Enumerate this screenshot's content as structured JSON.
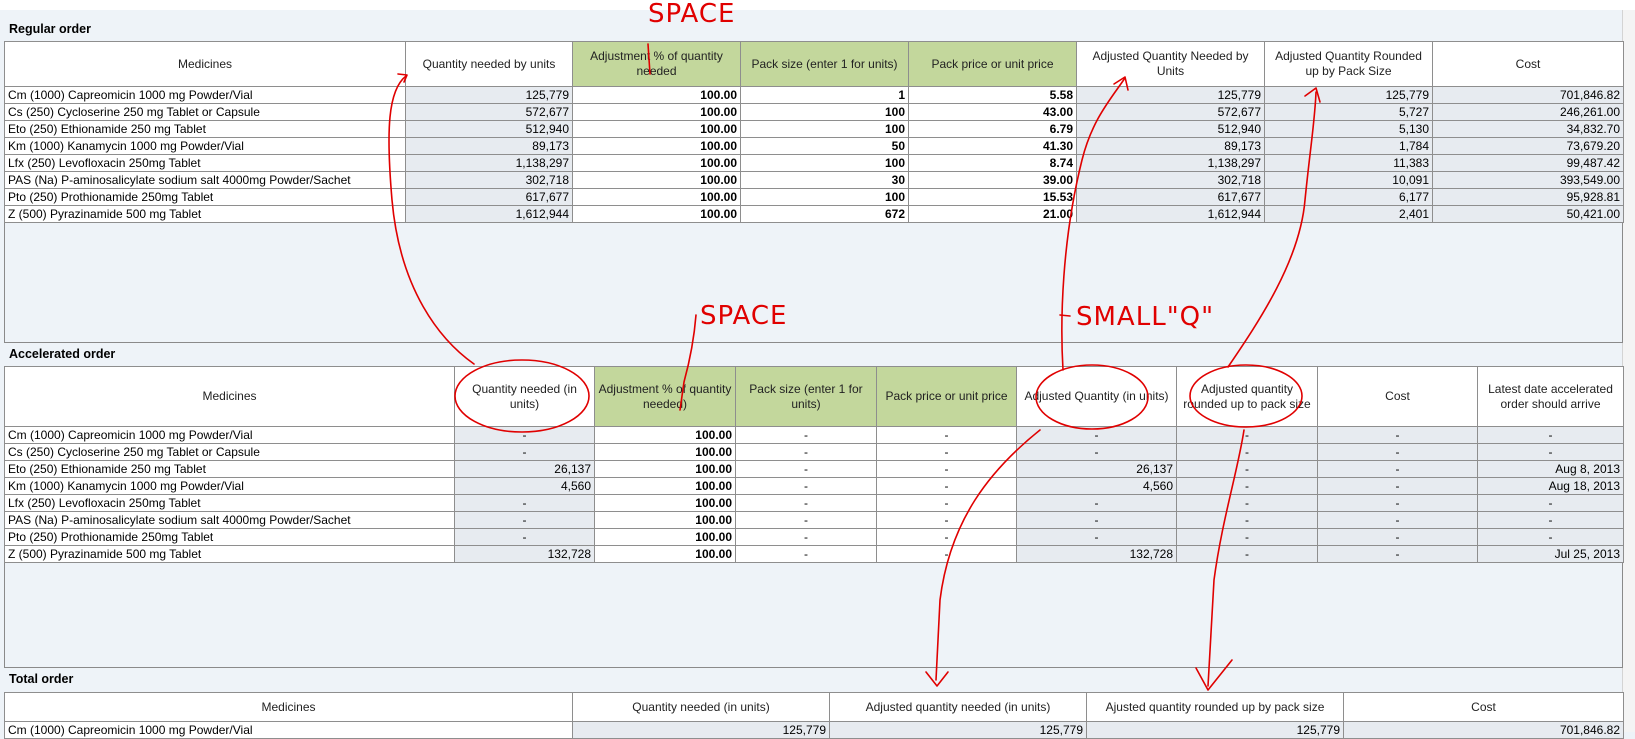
{
  "regular": {
    "title": "Regular order",
    "headers": [
      "Medicines",
      "Quantity needed by units",
      "Adjustment % of quantity needed",
      "Pack size (enter 1 for units)",
      "Pack price or unit price",
      "Adjusted Quantity Needed by Units",
      "Adjusted Quantity Rounded up by Pack Size",
      "Cost"
    ],
    "rows": [
      {
        "name": "Cm (1000)  Capreomicin  1000 mg  Powder/Vial",
        "qty": "125,779",
        "adj": "100.00",
        "pack": "1",
        "price": "5.58",
        "adjqty": "125,779",
        "rounded": "125,779",
        "cost": "701,846.82"
      },
      {
        "name": "Cs (250)  Cycloserine  250 mg  Tablet or Capsule",
        "qty": "572,677",
        "adj": "100.00",
        "pack": "100",
        "price": "43.00",
        "adjqty": "572,677",
        "rounded": "5,727",
        "cost": "246,261.00"
      },
      {
        "name": "Eto (250)  Ethionamide  250 mg  Tablet",
        "qty": "512,940",
        "adj": "100.00",
        "pack": "100",
        "price": "6.79",
        "adjqty": "512,940",
        "rounded": "5,130",
        "cost": "34,832.70"
      },
      {
        "name": "Km (1000)  Kanamycin  1000 mg  Powder/Vial",
        "qty": "89,173",
        "adj": "100.00",
        "pack": "50",
        "price": "41.30",
        "adjqty": "89,173",
        "rounded": "1,784",
        "cost": "73,679.20"
      },
      {
        "name": "Lfx (250)  Levofloxacin  250mg  Tablet",
        "qty": "1,138,297",
        "adj": "100.00",
        "pack": "100",
        "price": "8.74",
        "adjqty": "1,138,297",
        "rounded": "11,383",
        "cost": "99,487.42"
      },
      {
        "name": "PAS (Na)  P-aminosalicylate sodium salt  4000mg  Powder/Sachet",
        "qty": "302,718",
        "adj": "100.00",
        "pack": "30",
        "price": "39.00",
        "adjqty": "302,718",
        "rounded": "10,091",
        "cost": "393,549.00"
      },
      {
        "name": "Pto (250)  Prothionamide   250mg  Tablet",
        "qty": "617,677",
        "adj": "100.00",
        "pack": "100",
        "price": "15.53",
        "adjqty": "617,677",
        "rounded": "6,177",
        "cost": "95,928.81"
      },
      {
        "name": "Z (500)  Pyrazinamide  500 mg  Tablet",
        "qty": "1,612,944",
        "adj": "100.00",
        "pack": "672",
        "price": "21.00",
        "adjqty": "1,612,944",
        "rounded": "2,401",
        "cost": "50,421.00"
      }
    ]
  },
  "accelerated": {
    "title": "Accelerated order",
    "headers": [
      "Medicines",
      "Quantity needed (in units)",
      "Adjustment % of quantity needed)",
      "Pack size (enter 1 for units)",
      "Pack price or unit price",
      "Adjusted Quantity (in units)",
      "Adjusted quantity rounded up to pack size",
      "Cost",
      "Latest date accelerated order should arrive"
    ],
    "rows": [
      {
        "name": "Cm (1000)  Capreomicin  1000 mg  Powder/Vial",
        "qty": "-",
        "adj": "100.00",
        "pack": "-",
        "price": "-",
        "adjqty": "-",
        "rounded": "-",
        "cost": "-",
        "date": "-"
      },
      {
        "name": "Cs (250)  Cycloserine  250 mg  Tablet or Capsule",
        "qty": "-",
        "adj": "100.00",
        "pack": "-",
        "price": "-",
        "adjqty": "-",
        "rounded": "-",
        "cost": "-",
        "date": "-"
      },
      {
        "name": "Eto (250)  Ethionamide  250 mg  Tablet",
        "qty": "26,137",
        "adj": "100.00",
        "pack": "-",
        "price": "-",
        "adjqty": "26,137",
        "rounded": "-",
        "cost": "-",
        "date": "Aug 8, 2013"
      },
      {
        "name": "Km (1000)  Kanamycin  1000 mg  Powder/Vial",
        "qty": "4,560",
        "adj": "100.00",
        "pack": "-",
        "price": "-",
        "adjqty": "4,560",
        "rounded": "-",
        "cost": "-",
        "date": "Aug 18, 2013"
      },
      {
        "name": "Lfx (250)  Levofloxacin  250mg  Tablet",
        "qty": "-",
        "adj": "100.00",
        "pack": "-",
        "price": "-",
        "adjqty": "-",
        "rounded": "-",
        "cost": "-",
        "date": "-"
      },
      {
        "name": "PAS (Na)  P-aminosalicylate sodium salt  4000mg  Powder/Sachet",
        "qty": "-",
        "adj": "100.00",
        "pack": "-",
        "price": "-",
        "adjqty": "-",
        "rounded": "-",
        "cost": "-",
        "date": "-"
      },
      {
        "name": "Pto (250)  Prothionamide   250mg  Tablet",
        "qty": "-",
        "adj": "100.00",
        "pack": "-",
        "price": "-",
        "adjqty": "-",
        "rounded": "-",
        "cost": "-",
        "date": "-"
      },
      {
        "name": "Z (500)  Pyrazinamide  500 mg  Tablet",
        "qty": "132,728",
        "adj": "100.00",
        "pack": "-",
        "price": "-",
        "adjqty": "132,728",
        "rounded": "-",
        "cost": "-",
        "date": "Jul 25, 2013"
      }
    ]
  },
  "total": {
    "title": "Total order",
    "headers": [
      "Medicines",
      "Quantity needed (in units)",
      "Adjusted quantity needed (in units)",
      "Ajusted quantity rounded up by pack size",
      "Cost"
    ],
    "rows": [
      {
        "name": "Cm (1000)  Capreomicin  1000 mg  Powder/Vial",
        "qty": "125,779",
        "adjqty": "125,779",
        "rounded": "125,779",
        "cost": "701,846.82"
      }
    ]
  },
  "annotations": {
    "space_top": "SPACE",
    "space_mid": "SPACE",
    "small_q": "SMALL\"Q\"",
    "color": "#e00000"
  }
}
